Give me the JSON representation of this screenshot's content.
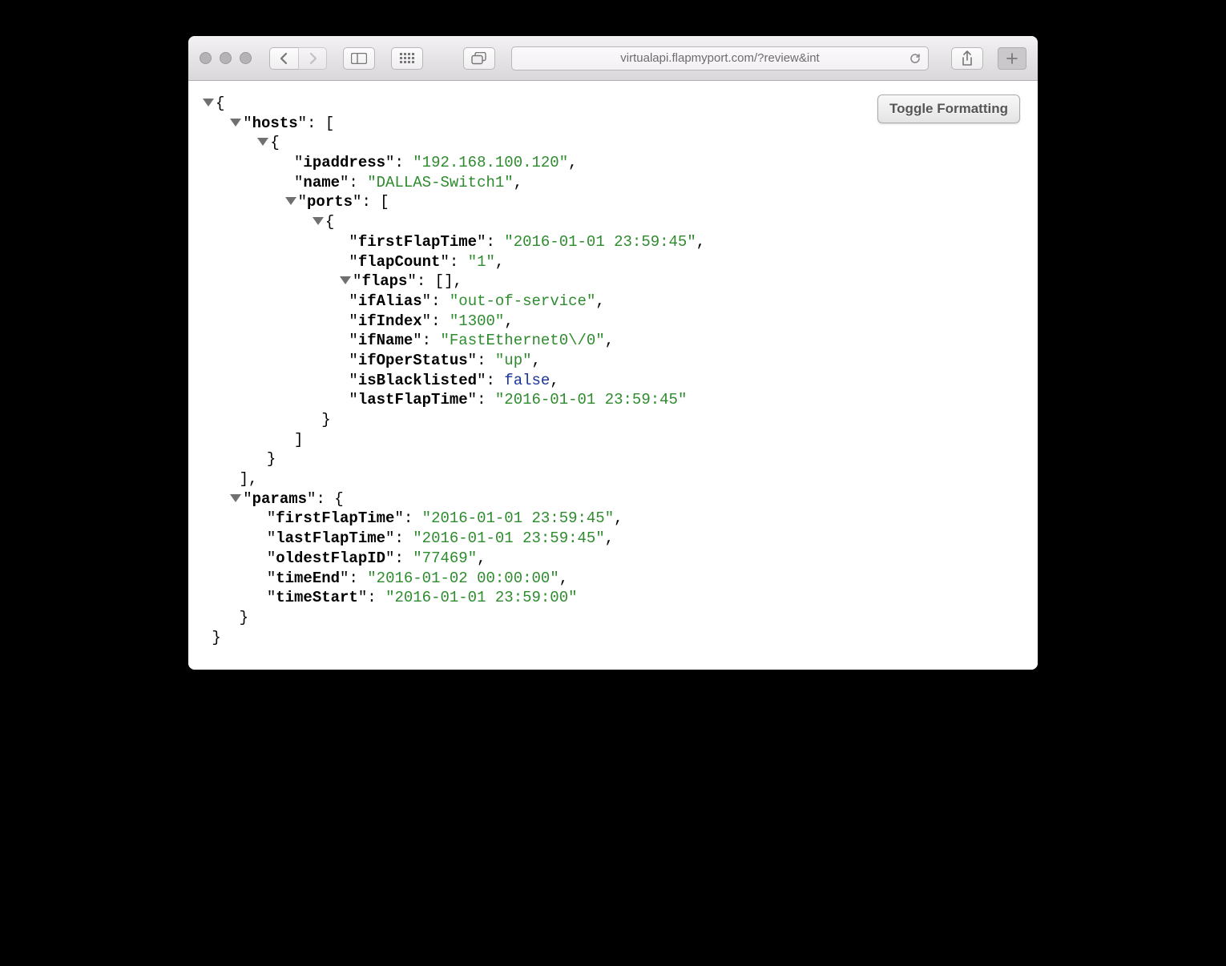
{
  "toolbar": {
    "url": "virtualapi.flapmyport.com/?review&int",
    "toggle_label": "Toggle Formatting"
  },
  "json_view": {
    "root": {
      "hosts_label": "hosts",
      "hosts": [
        {
          "ipaddress_label": "ipaddress",
          "ipaddress": "192.168.100.120",
          "name_label": "name",
          "name": "DALLAS-Switch1",
          "ports_label": "ports",
          "ports": [
            {
              "firstFlapTime_label": "firstFlapTime",
              "firstFlapTime": "2016-01-01 23:59:45",
              "flapCount_label": "flapCount",
              "flapCount": "1",
              "flaps_label": "flaps",
              "flaps_display": "[]",
              "ifAlias_label": "ifAlias",
              "ifAlias": "out-of-service",
              "ifIndex_label": "ifIndex",
              "ifIndex": "1300",
              "ifName_label": "ifName",
              "ifName": "FastEthernet0\\/0",
              "ifOperStatus_label": "ifOperStatus",
              "ifOperStatus": "up",
              "isBlacklisted_label": "isBlacklisted",
              "isBlacklisted": "false",
              "lastFlapTime_label": "lastFlapTime",
              "lastFlapTime": "2016-01-01 23:59:45"
            }
          ]
        }
      ],
      "params_label": "params",
      "params": {
        "firstFlapTime_label": "firstFlapTime",
        "firstFlapTime": "2016-01-01 23:59:45",
        "lastFlapTime_label": "lastFlapTime",
        "lastFlapTime": "2016-01-01 23:59:45",
        "oldestFlapID_label": "oldestFlapID",
        "oldestFlapID": "77469",
        "timeEnd_label": "timeEnd",
        "timeEnd": "2016-01-02 00:00:00",
        "timeStart_label": "timeStart",
        "timeStart": "2016-01-01 23:59:00"
      }
    }
  }
}
